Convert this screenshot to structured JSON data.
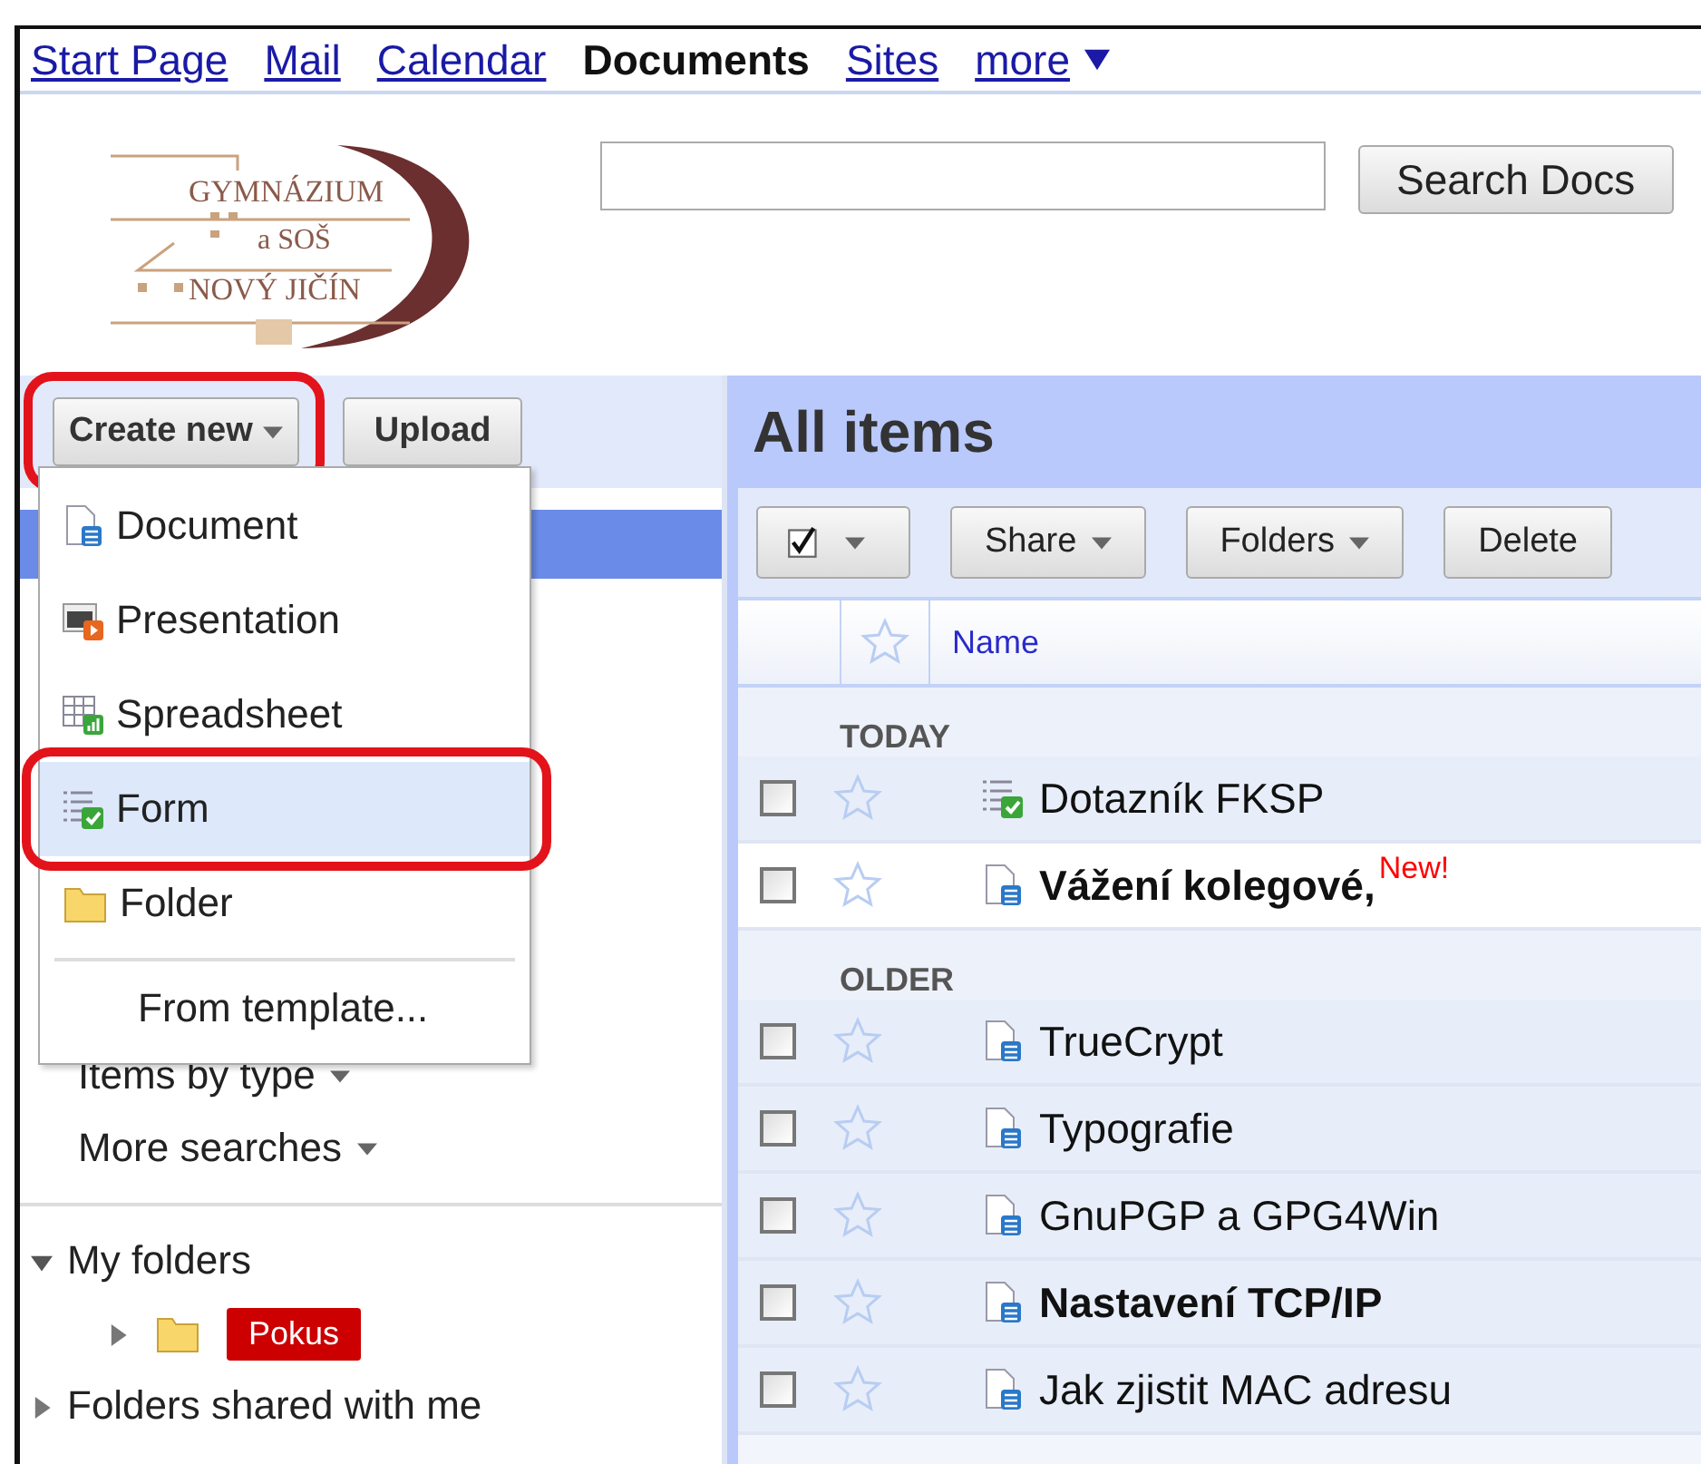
{
  "nav": [
    {
      "label": "Start Page",
      "selected": false
    },
    {
      "label": "Mail",
      "selected": false
    },
    {
      "label": "Calendar",
      "selected": false
    },
    {
      "label": "Documents",
      "selected": true
    },
    {
      "label": "Sites",
      "selected": false
    },
    {
      "label": "more",
      "selected": false
    }
  ],
  "logo": {
    "lines": [
      "GYMNÁZIUM",
      "a SOŠ",
      "NOVÝ JIČÍN"
    ]
  },
  "search": {
    "button": "Search Docs"
  },
  "create_button": {
    "label": "Create new",
    "circled": true
  },
  "upload_button": {
    "label": "Upload"
  },
  "create_menu": {
    "items": [
      {
        "kind": "document",
        "label": "Document",
        "selected": false,
        "circled": false
      },
      {
        "kind": "presentation",
        "label": "Presentation",
        "selected": false,
        "circled": false
      },
      {
        "kind": "spreadsheet",
        "label": "Spreadsheet",
        "selected": false,
        "circled": false
      },
      {
        "kind": "form",
        "label": "Form",
        "selected": true,
        "circled": true
      },
      {
        "kind": "folder",
        "label": "Folder",
        "selected": false,
        "circled": false
      }
    ],
    "template": "From template..."
  },
  "sidebar": {
    "searches": [
      {
        "label": "Items by type"
      },
      {
        "label": "More searches"
      }
    ],
    "folders": [
      {
        "label": "My folders",
        "expanded": true,
        "children": [
          {
            "label": "Pokus",
            "expanded": false,
            "color": "#cc0000"
          }
        ]
      },
      {
        "label": "Folders shared with me",
        "expanded": false
      }
    ]
  },
  "main": {
    "title": "All items",
    "toolbar": [
      {
        "kind": "dropdown",
        "label": "Share"
      },
      {
        "kind": "dropdown",
        "label": "Folders"
      },
      {
        "kind": "button",
        "label": "Delete"
      }
    ],
    "column": "Name",
    "groups": [
      {
        "label": "TODAY",
        "rows": [
          {
            "kind": "form",
            "name": "Dotazník FKSP",
            "unread": false,
            "selected": false,
            "checked": false,
            "starred": false
          },
          {
            "kind": "document",
            "name": "Vážení kolegové,",
            "unread": true,
            "selected": true,
            "checked": false,
            "starred": false,
            "badge": "New!"
          }
        ]
      },
      {
        "label": "OLDER",
        "rows": [
          {
            "kind": "document",
            "name": "TrueCrypt",
            "unread": false,
            "selected": false,
            "checked": false,
            "starred": false
          },
          {
            "kind": "document",
            "name": "Typografie",
            "unread": false,
            "selected": false,
            "checked": false,
            "starred": false
          },
          {
            "kind": "document",
            "name": "GnuPGP a GPG4Win",
            "unread": false,
            "selected": false,
            "checked": false,
            "starred": false
          },
          {
            "kind": "document",
            "name": "Nastavení TCP/IP",
            "unread": true,
            "selected": false,
            "checked": false,
            "starred": false
          },
          {
            "kind": "document",
            "name": "Jak zjistit MAC adresu",
            "unread": false,
            "selected": false,
            "checked": false,
            "starred": false
          }
        ]
      }
    ]
  }
}
